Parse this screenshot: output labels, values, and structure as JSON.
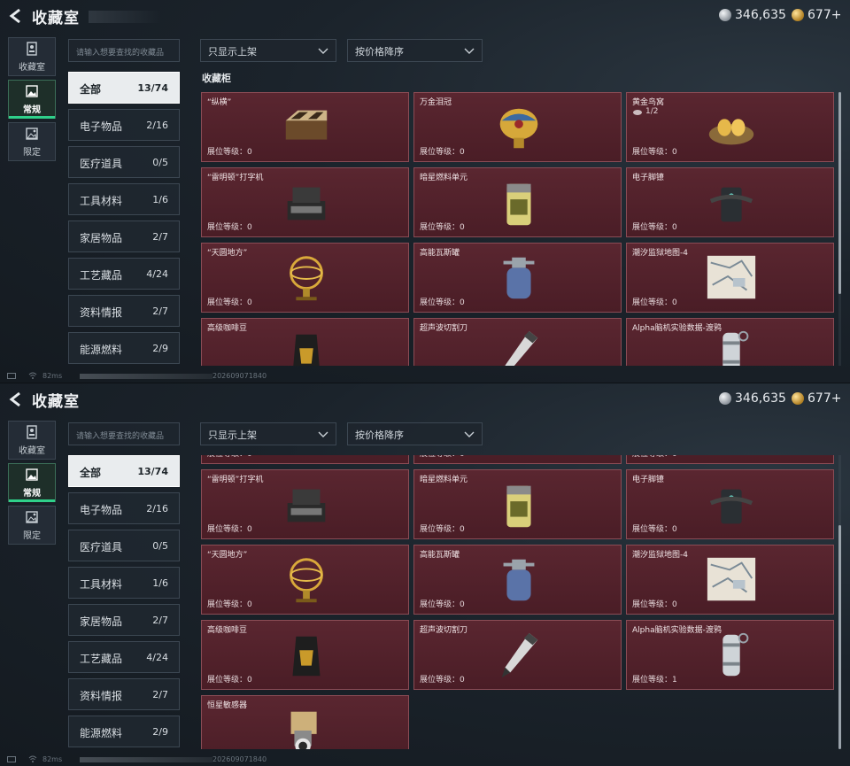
{
  "header": {
    "title": "收藏室"
  },
  "currency": {
    "silver": "346,635",
    "gold": "677+"
  },
  "rail": [
    {
      "label": "收藏室",
      "icon": "archive-icon",
      "active": false
    },
    {
      "label": "常规",
      "icon": "image-icon",
      "active": true
    },
    {
      "label": "限定",
      "icon": "limited-icon",
      "active": false
    }
  ],
  "search": {
    "placeholder": "请输入想要查找的收藏品"
  },
  "filters": {
    "shelf": "只显示上架",
    "sort": "按价格降序"
  },
  "section_title": "收藏柜",
  "categories": [
    {
      "name": "全部",
      "count": "13/74"
    },
    {
      "name": "电子物品",
      "count": "2/16"
    },
    {
      "name": "医疗道具",
      "count": "0/5"
    },
    {
      "name": "工具材料",
      "count": "1/6"
    },
    {
      "name": "家居物品",
      "count": "2/7"
    },
    {
      "name": "工艺藏品",
      "count": "4/24"
    },
    {
      "name": "资料情报",
      "count": "2/7"
    },
    {
      "name": "能源燃料",
      "count": "2/9"
    }
  ],
  "level_label": "展位等级：",
  "items": [
    {
      "name": "“纵横”",
      "level": "0",
      "icon": "chessboard-icon"
    },
    {
      "name": "万金泪冠",
      "level": "0",
      "icon": "jeweled-egg-icon"
    },
    {
      "name": "黄金鸟窝",
      "level": "0",
      "sub": "1/2",
      "icon": "golden-nest-icon"
    },
    {
      "name": "“雷明顿”打字机",
      "level": "0",
      "icon": "typewriter-icon"
    },
    {
      "name": "暗星燃料单元",
      "level": "0",
      "icon": "fuel-cell-icon"
    },
    {
      "name": "电子脚镣",
      "level": "0",
      "icon": "ankle-monitor-icon"
    },
    {
      "name": "“天圆地方”",
      "level": "0",
      "icon": "armillary-sphere-icon"
    },
    {
      "name": "高能瓦斯罐",
      "level": "0",
      "icon": "gas-tank-icon"
    },
    {
      "name": "潮汐监狱地图-4",
      "level": "0",
      "icon": "map-icon"
    },
    {
      "name": "高级咖啡豆",
      "level": "0",
      "icon": "coffee-bag-icon"
    },
    {
      "name": "超声波切割刀",
      "level": "0",
      "icon": "cutter-icon"
    },
    {
      "name": "Alpha脑机实验数据-渡鸦",
      "level": "1",
      "icon": "data-canister-icon"
    },
    {
      "name": "恒星敏感器",
      "level": "0",
      "icon": "star-sensor-icon"
    }
  ],
  "status": {
    "ping": "82ms",
    "id": "202609071840"
  },
  "colors": {
    "card_bg": "#5a2630",
    "card_border": "#8a4c55",
    "accent": "#2fd08a"
  }
}
